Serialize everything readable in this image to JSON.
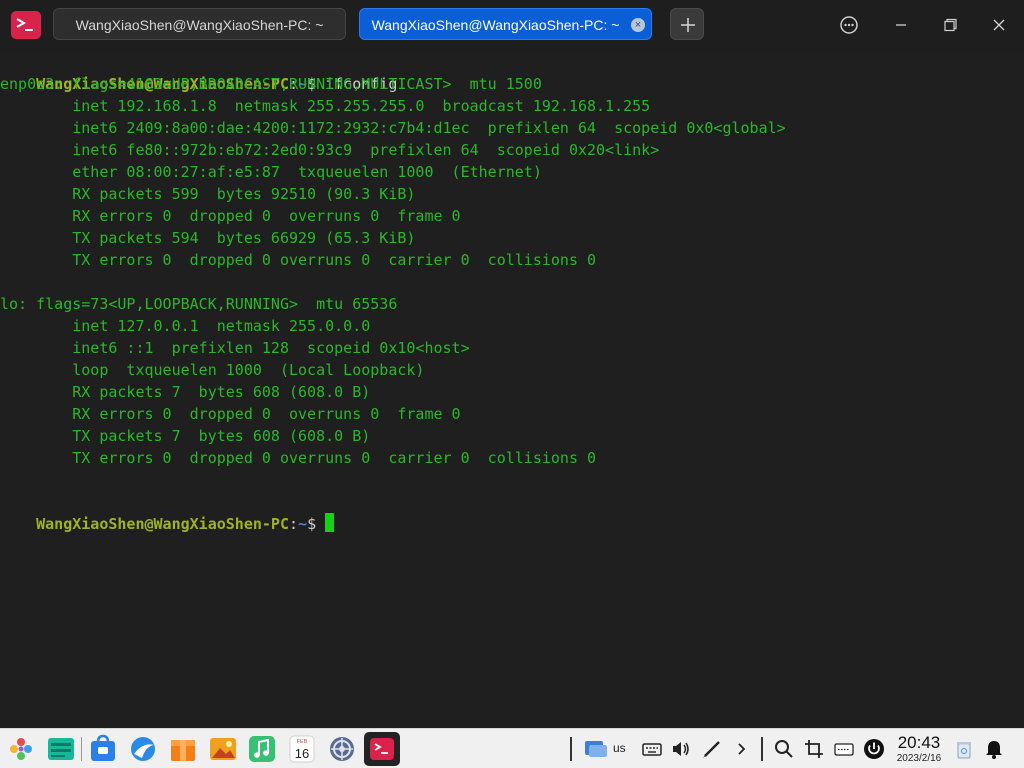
{
  "tabs": [
    {
      "label": "WangXiaoShen@WangXiaoShen-PC: ~",
      "active": false
    },
    {
      "label": "WangXiaoShen@WangXiaoShen-PC: ~",
      "active": true
    }
  ],
  "tab_close_glyph": "×",
  "icons": {
    "app": "terminal-app-icon",
    "new_tab": "plus-icon",
    "menu": "more-options-icon",
    "minimize": "minimize-icon",
    "maximize": "restore-icon",
    "close": "close-icon"
  },
  "colors": {
    "accent_tab": "#0a5fd6",
    "terminal_bg": "#1f1f1f",
    "output_text": "#2ab82a",
    "prompt_user": "#9fb420",
    "prompt_path": "#3f86d6",
    "cursor": "#19d019"
  },
  "prompt": {
    "user_host": "WangXiaoShen@WangXiaoShen-PC",
    "colon": ":",
    "path": "~",
    "dollar": "$ "
  },
  "command": "ifconfig",
  "output_lines": [
    "enp0s3: flags=4163<UP,BROADCAST,RUNNING,MULTICAST>  mtu 1500",
    "        inet 192.168.1.8  netmask 255.255.255.0  broadcast 192.168.1.255",
    "        inet6 2409:8a00:dae:4200:1172:2932:c7b4:d1ec  prefixlen 64  scopeid 0x0<global>",
    "        inet6 fe80::972b:eb72:2ed0:93c9  prefixlen 64  scopeid 0x20<link>",
    "        ether 08:00:27:af:e5:87  txqueuelen 1000  (Ethernet)",
    "        RX packets 599  bytes 92510 (90.3 KiB)",
    "        RX errors 0  dropped 0  overruns 0  frame 0",
    "        TX packets 594  bytes 66929 (65.3 KiB)",
    "        TX errors 0  dropped 0 overruns 0  carrier 0  collisions 0",
    "",
    "lo: flags=73<UP,LOOPBACK,RUNNING>  mtu 65536",
    "        inet 127.0.0.1  netmask 255.0.0.0",
    "        inet6 ::1  prefixlen 128  scopeid 0x10<host>",
    "        loop  txqueuelen 1000  (Local Loopback)",
    "        RX packets 7  bytes 608 (608.0 B)",
    "        RX errors 0  dropped 0  overruns 0  frame 0",
    "        TX packets 7  bytes 608 (608.0 B)",
    "        TX errors 0  dropped 0 overruns 0  carrier 0  collisions 0",
    ""
  ],
  "taskbar": {
    "apps": [
      "launcher-icon",
      "file-manager-icon",
      "app-store-icon",
      "browser-icon",
      "package-icon",
      "image-viewer-icon",
      "music-icon",
      "calendar-icon",
      "settings-icon",
      "terminal-icon"
    ],
    "calendar_month": "FEB",
    "calendar_day": "16",
    "keyboard_layout": "us",
    "tray": [
      "network-icon",
      "keyboard-icon",
      "volume-icon",
      "pen-icon",
      "expand-arrow-icon",
      "search-icon",
      "screenshot-icon",
      "onscreen-keyboard-icon",
      "power-icon",
      "trash-icon",
      "notification-icon"
    ],
    "time": "20:43",
    "date": "2023/2/16"
  }
}
